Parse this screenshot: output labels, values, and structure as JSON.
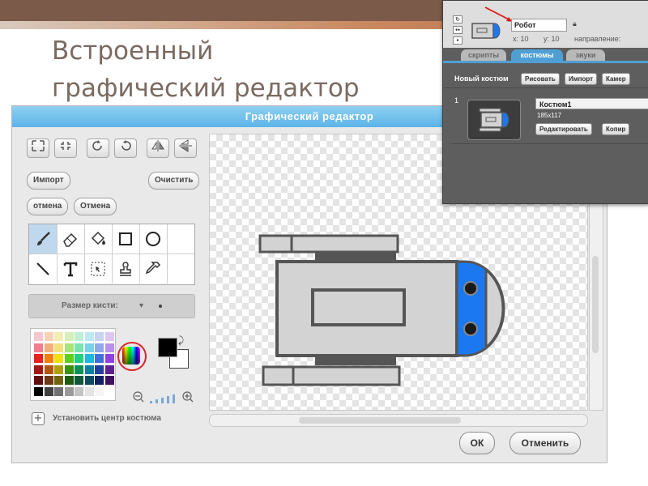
{
  "slide": {
    "title": "Встроенный\nграфический редактор"
  },
  "editor": {
    "title": "Графический редактор",
    "buttons": {
      "import": "Импорт",
      "clear": "Очистить",
      "undo": "отмена",
      "redo": "Отмена",
      "ok": "ОК",
      "cancel": "Отменить"
    },
    "brush_size_label": "Размер кисти:",
    "set_center_label": "Установить центр костюма",
    "tools": [
      "brush-icon",
      "eraser-icon",
      "fill-icon",
      "rectangle-icon",
      "ellipse-icon",
      "line-icon",
      "text-icon",
      "select-icon",
      "stamp-icon",
      "eyedropper-icon"
    ],
    "toolbar_icons": [
      "zoom-fit-icon",
      "zoom-reset-icon",
      "rotate-left-icon",
      "rotate-right-icon",
      "flip-horizontal-icon",
      "flip-vertical-icon"
    ],
    "colors": {
      "accent": "#5bb4e8",
      "foreground": "#000000",
      "background": "#ffffff",
      "robot_blue": "#1c78f0",
      "robot_gray": "#d3d3d3",
      "robot_outline": "#555555"
    },
    "palette": [
      "#f4c6d0",
      "#f6d3b8",
      "#f5ecb5",
      "#d5f0b8",
      "#bdf0d5",
      "#bde7f2",
      "#c8d3f2",
      "#dcc8f2",
      "#ef7f8f",
      "#f4b07a",
      "#f2e07a",
      "#a8e37a",
      "#7ae3b0",
      "#7ad1e8",
      "#8fa8ec",
      "#bb8fec",
      "#e82020",
      "#f08010",
      "#f0e010",
      "#60d020",
      "#20d080",
      "#20b8e0",
      "#4070e0",
      "#9040e0",
      "#a01818",
      "#b05810",
      "#b0a010",
      "#3a9010",
      "#109058",
      "#1080a0",
      "#2040a0",
      "#602090",
      "#601010",
      "#703810",
      "#706410",
      "#205810",
      "#105838",
      "#104860",
      "#102060",
      "#401060",
      "#000000",
      "#404040",
      "#707070",
      "#9a9a9a",
      "#c4c4c4",
      "#e4e4e4",
      "#f4f4f4",
      "#ffffff"
    ]
  },
  "inset": {
    "sprite_name": "Робот",
    "x_label": "x: 10",
    "y_label": "y: 10",
    "direction_label": "направление:",
    "tabs": {
      "scripts": "скрипты",
      "costumes": "костюмы",
      "sounds": "звуки"
    },
    "new_costume": "Новый костюм",
    "paint": "Рисовать",
    "import": "Импорт",
    "camera": "Камер",
    "costume_number": "1",
    "costume_name": "Костюм1",
    "costume_size": "185x117",
    "edit": "Редактировать",
    "copy": "Копир"
  }
}
